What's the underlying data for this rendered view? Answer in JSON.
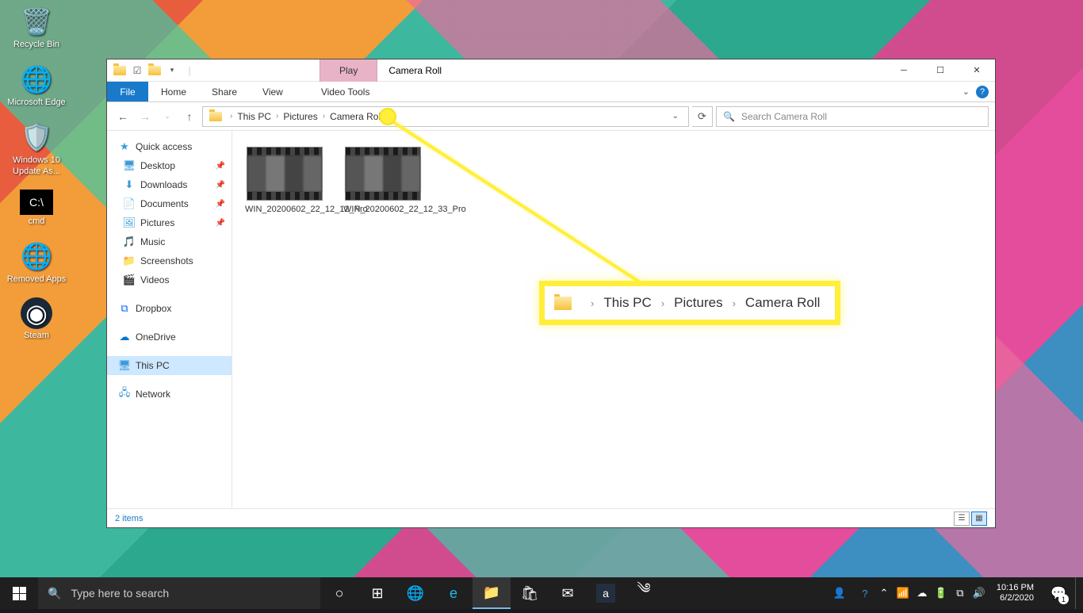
{
  "desktop_icons": [
    {
      "label": "Recycle Bin",
      "glyph": "🗑"
    },
    {
      "label": "Microsoft Edge",
      "glyph": "🌐"
    },
    {
      "label": "Windows 10 Update As...",
      "glyph": "⚙"
    },
    {
      "label": "cmd",
      "glyph": "▮"
    },
    {
      "label": "Removed Apps",
      "glyph": "🌐"
    },
    {
      "label": "Steam",
      "glyph": "◉"
    }
  ],
  "explorer": {
    "qat_play": "Play",
    "title": "Camera Roll",
    "ribbon": {
      "file": "File",
      "home": "Home",
      "share": "Share",
      "view": "View",
      "video_tools": "Video Tools"
    },
    "breadcrumb": [
      "This PC",
      "Pictures",
      "Camera Roll"
    ],
    "search_placeholder": "Search Camera Roll",
    "nav": {
      "quick_access": "Quick access",
      "items1": [
        {
          "label": "Desktop",
          "icon": "🖥",
          "pinned": true
        },
        {
          "label": "Downloads",
          "icon": "⬇",
          "pinned": true
        },
        {
          "label": "Documents",
          "icon": "📄",
          "pinned": true
        },
        {
          "label": "Pictures",
          "icon": "🖼",
          "pinned": true
        },
        {
          "label": "Music",
          "icon": "🎵",
          "pinned": false
        },
        {
          "label": "Screenshots",
          "icon": "📁",
          "pinned": false
        },
        {
          "label": "Videos",
          "icon": "🎬",
          "pinned": false
        }
      ],
      "dropbox": "Dropbox",
      "onedrive": "OneDrive",
      "this_pc": "This PC",
      "network": "Network"
    },
    "files": [
      {
        "name": "WIN_20200602_22_12_12_Pro"
      },
      {
        "name": "WIN_20200602_22_12_33_Pro"
      }
    ],
    "status": "2 items"
  },
  "callout": {
    "path": [
      "This PC",
      "Pictures",
      "Camera Roll"
    ]
  },
  "taskbar": {
    "search_placeholder": "Type here to search",
    "time": "10:16 PM",
    "date": "6/2/2020",
    "notif_count": "1"
  }
}
